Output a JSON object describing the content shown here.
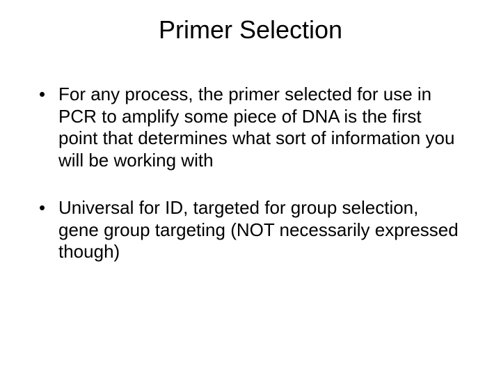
{
  "slide": {
    "title": "Primer Selection",
    "bullets": [
      "For any process, the primer selected for use in PCR to amplify some piece of DNA is the first point that determines what sort of information you will be working with",
      "Universal for ID, targeted for group selection, gene group targeting (NOT necessarily expressed though)"
    ]
  }
}
